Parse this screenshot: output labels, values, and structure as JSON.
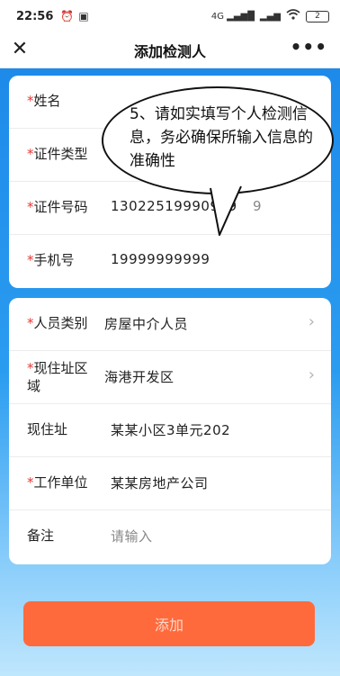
{
  "statusbar": {
    "time": "22:56",
    "alarm_icon": "alarm-icon",
    "message_icon": "message-icon",
    "signal1": "4G ▂▄▆█",
    "signal2": "▂▄▆",
    "wifi_icon": "wifi-icon",
    "battery": "2"
  },
  "navbar": {
    "close": "✕",
    "title": "添加检测人",
    "more": "•••"
  },
  "card1": {
    "name_label": "姓名",
    "id_type_label": "证件类型",
    "id_number_label": "证件号码",
    "id_number_value": "13022519990909",
    "id_number_tail": "9",
    "phone_label": "手机号",
    "phone_value": "19999999999"
  },
  "card2": {
    "category_label": "人员类别",
    "category_value": "房屋中介人员",
    "region_label": "现住址区域",
    "region_value": "海港开发区",
    "address_label": "现住址",
    "address_value": "某某小区3单元202",
    "work_label": "工作单位",
    "work_value": "某某房地产公司",
    "remark_label": "备注",
    "remark_placeholder": "请输入"
  },
  "bubble": {
    "text": "5、请如实填写个人检测信息，务必确保所输入信息的准确性"
  },
  "required_mark": "*",
  "arrow_glyph": "›",
  "add_button": "添加",
  "colors": {
    "accent": "#1b86e8",
    "button": "#ff6a3d",
    "required": "#e53935"
  }
}
